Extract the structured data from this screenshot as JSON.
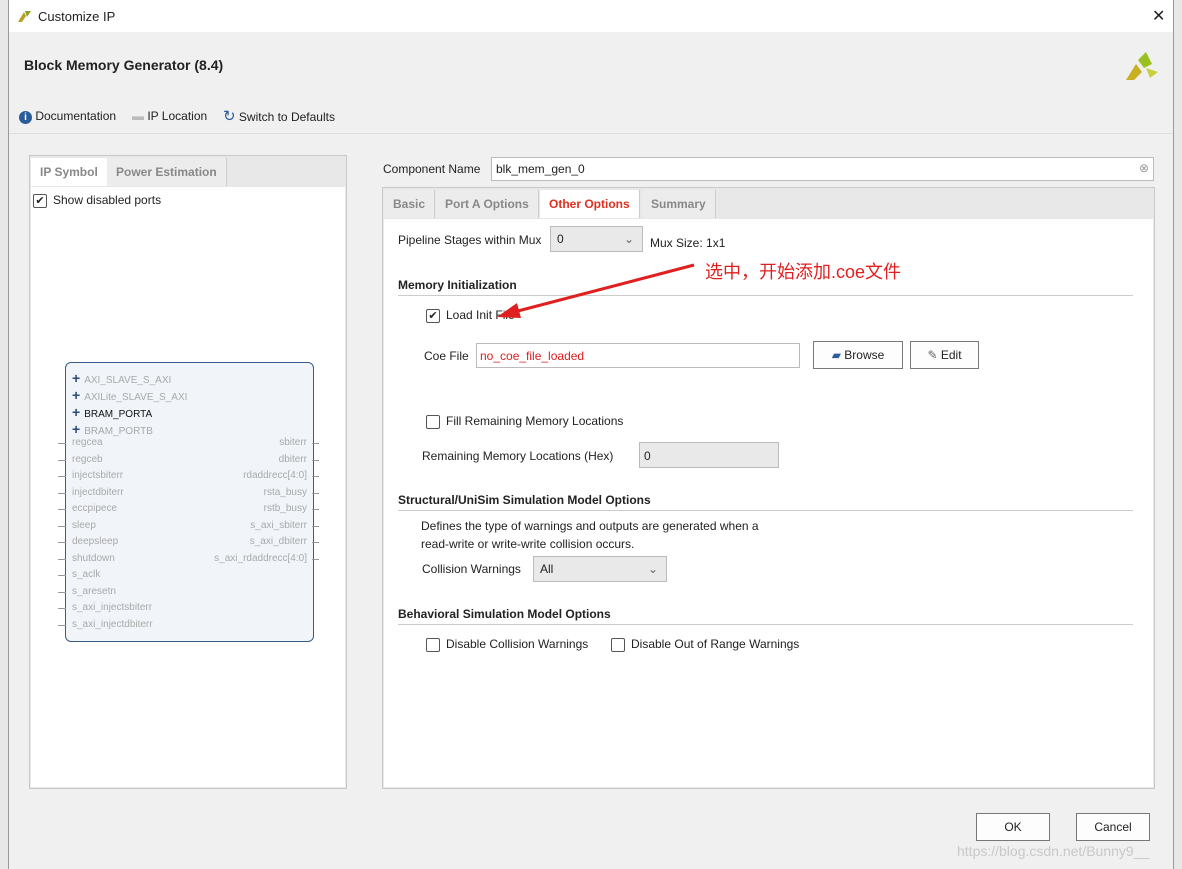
{
  "window": {
    "title": "Customize IP",
    "close": "✕"
  },
  "header": {
    "title": "Block Memory Generator (8.4)",
    "documentation": "Documentation",
    "ip_location": "IP Location",
    "switch_defaults": "Switch to Defaults"
  },
  "left": {
    "tabs": [
      "IP Symbol",
      "Power Estimation"
    ],
    "show_disabled_ports": "Show disabled ports",
    "show_disabled_checked": true,
    "buses": [
      {
        "name": "AXI_SLAVE_S_AXI",
        "enabled": false
      },
      {
        "name": "AXILite_SLAVE_S_AXI",
        "enabled": false
      },
      {
        "name": "BRAM_PORTA",
        "enabled": true
      },
      {
        "name": "BRAM_PORTB",
        "enabled": false
      }
    ],
    "left_ports": [
      "regcea",
      "regceb",
      "injectsbiterr",
      "injectdbiterr",
      "eccpipece",
      "sleep",
      "deepsleep",
      "shutdown",
      "s_aclk",
      "s_aresetn",
      "s_axi_injectsbiterr",
      "s_axi_injectdbiterr"
    ],
    "right_ports": [
      "sbiterr",
      "dbiterr",
      "rdaddrecc[4:0]",
      "rsta_busy",
      "rstb_busy",
      "s_axi_sbiterr",
      "s_axi_dbiterr",
      "s_axi_rdaddrecc[4:0]"
    ]
  },
  "right": {
    "component_name_label": "Component Name",
    "component_name": "blk_mem_gen_0",
    "tabs": [
      "Basic",
      "Port A Options",
      "Other Options",
      "Summary"
    ],
    "active_tab": "Other Options",
    "pipeline_label": "Pipeline Stages within Mux",
    "pipeline_value": "0",
    "mux_size": "Mux Size: 1x1",
    "mem_init_title": "Memory Initialization",
    "load_init_file": "Load Init File",
    "load_init_checked": true,
    "coe_label": "Coe File",
    "coe_value": "no_coe_file_loaded",
    "browse": "Browse",
    "edit": "Edit",
    "fill_remaining": "Fill Remaining Memory Locations",
    "remaining_label": "Remaining Memory Locations (Hex)",
    "remaining_value": "0",
    "structural_title": "Structural/UniSim Simulation Model Options",
    "structural_desc1": "Defines the type of warnings and outputs are generated when a",
    "structural_desc2": "read-write or write-write collision occurs.",
    "collision_label": "Collision Warnings",
    "collision_value": "All",
    "behavioral_title": "Behavioral Simulation Model Options",
    "disable_collision": "Disable Collision Warnings",
    "disable_oor": "Disable Out of Range Warnings"
  },
  "footer": {
    "ok": "OK",
    "cancel": "Cancel"
  },
  "annotation": {
    "text": "选中，开始添加.coe文件",
    "color": "#e02020"
  },
  "watermark": "https://blog.csdn.net/Bunny9__"
}
